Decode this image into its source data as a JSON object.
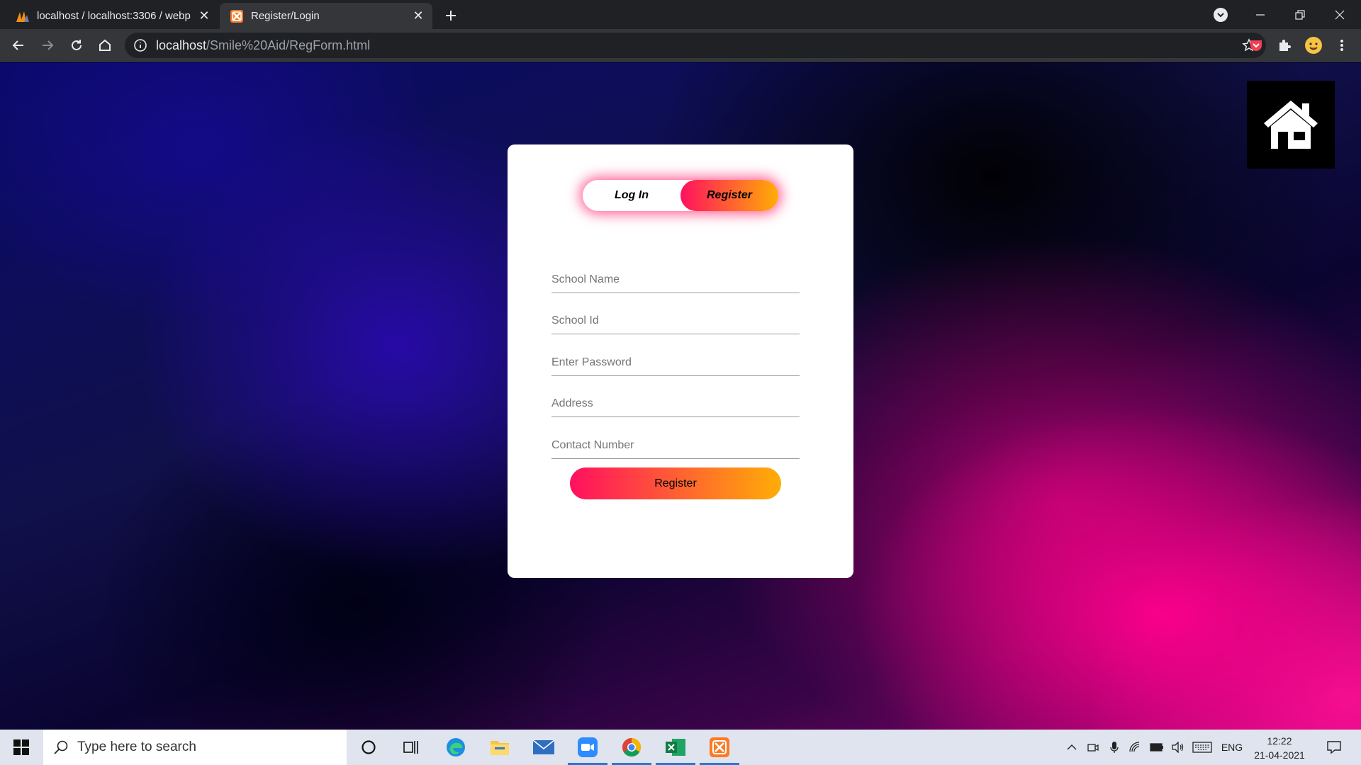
{
  "browser": {
    "tabs": [
      {
        "title": "localhost / localhost:3306 / webp",
        "active": false,
        "favicon": "phpmyadmin-icon"
      },
      {
        "title": "Register/Login",
        "active": true,
        "favicon": "xampp-icon"
      }
    ],
    "url_host": "localhost",
    "url_path": "/Smile%20Aid/RegForm.html"
  },
  "form": {
    "toggle": {
      "login_label": "Log In",
      "register_label": "Register",
      "selected": "Register"
    },
    "fields": {
      "school_name": "School Name",
      "school_id": "School Id",
      "password": "Enter Password",
      "address": "Address",
      "contact": "Contact Number"
    },
    "submit_label": "Register"
  },
  "colors": {
    "accent_start": "#ff105f",
    "accent_end": "#ffad06"
  },
  "taskbar": {
    "search_placeholder": "Type here to search",
    "language": "ENG",
    "time": "12:22",
    "date": "21-04-2021"
  }
}
